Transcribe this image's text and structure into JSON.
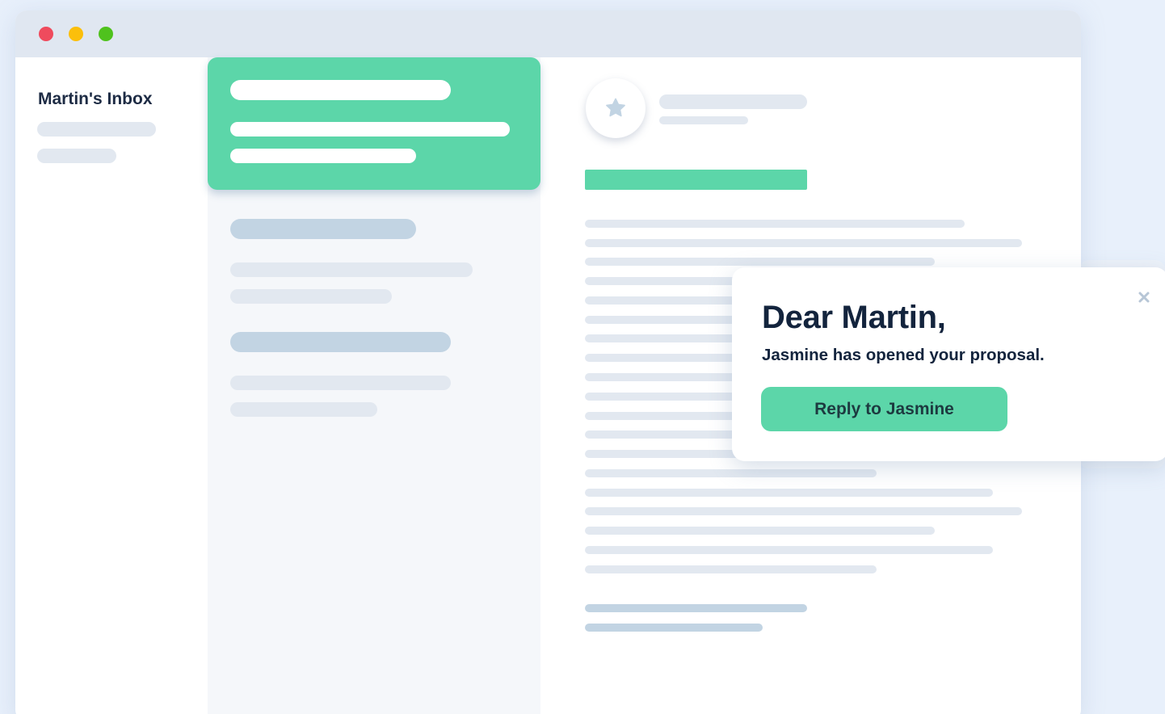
{
  "window": {
    "traffic_lights": [
      "#ef4b5d",
      "#fbbf0b",
      "#4fc21d"
    ]
  },
  "sidebar": {
    "title": "Martin's Inbox"
  },
  "notification": {
    "heading": "Dear Martin,",
    "message": "Jasmine has opened your proposal.",
    "reply_label": "Reply to Jasmine",
    "close_icon": "close-icon"
  },
  "reading_pane": {
    "avatar_icon": "star-icon"
  },
  "colors": {
    "accent": "#5cd6a9",
    "skeleton_light": "#e2e8f0",
    "skeleton_dark": "#c2d4e3",
    "heading_text": "#13243d",
    "titlebar": "#e0e7f1"
  }
}
